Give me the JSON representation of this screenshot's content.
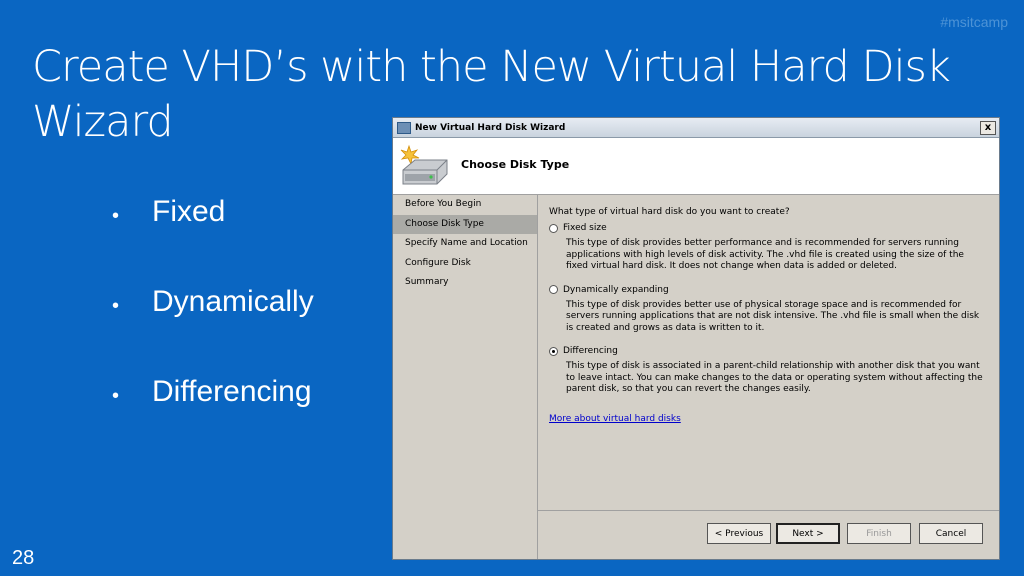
{
  "slide": {
    "hashtag": "#msitcamp",
    "title": "Create VHD’s with the New Virtual Hard Disk Wizard",
    "bullets": [
      "Fixed",
      "Dynamically",
      "Differencing"
    ],
    "slide_number": "28"
  },
  "window": {
    "title": "New Virtual Hard Disk Wizard",
    "close_label": "x",
    "header_title": "Choose Disk Type",
    "nav": {
      "items": [
        {
          "label": "Before You Begin"
        },
        {
          "label": "Choose Disk Type",
          "selected": true
        },
        {
          "label": "Specify Name and Location"
        },
        {
          "label": "Configure Disk"
        },
        {
          "label": "Summary"
        }
      ]
    },
    "content": {
      "question": "What type of virtual hard disk do you want to create?",
      "options": [
        {
          "label": "Fixed size",
          "checked": false,
          "description": "This type of disk provides better performance and is recommended for servers running applications with high levels of disk activity. The .vhd file is created using the size of the fixed virtual hard disk. It does not change when data is added or deleted."
        },
        {
          "label": "Dynamically expanding",
          "checked": false,
          "description": "This type of disk provides better use of physical storage space and is recommended for servers running applications that are not disk intensive. The .vhd file is small when the disk is created and grows as data is written to it."
        },
        {
          "label": "Differencing",
          "checked": true,
          "description": "This type of disk is associated in a parent-child relationship with another disk that you want to leave intact. You can make changes to the data or operating system without affecting the parent disk, so that you can revert the changes easily."
        }
      ],
      "more_link": "More about virtual hard disks"
    },
    "buttons": {
      "previous": "< Previous",
      "next": "Next >",
      "finish": "Finish",
      "cancel": "Cancel"
    }
  },
  "colors": {
    "slide_background": "#0a66c2",
    "nav_selected": "#aaaaa6"
  }
}
